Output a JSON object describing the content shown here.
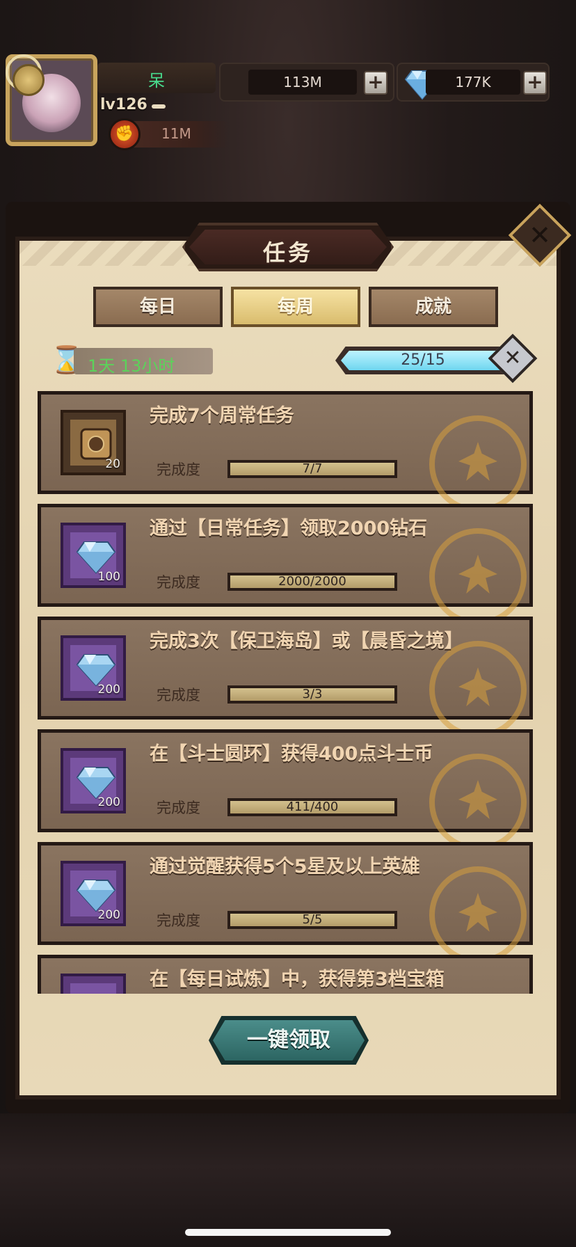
{
  "player": {
    "name": "呆",
    "level": "lv126",
    "power": "11M"
  },
  "resources": {
    "gold": "113M",
    "gems": "177K"
  },
  "dialog": {
    "title": "任务",
    "close_label": "✕"
  },
  "tabs": [
    {
      "label": "每日",
      "active": false
    },
    {
      "label": "每周",
      "active": true
    },
    {
      "label": "成就",
      "active": false
    }
  ],
  "timer": "1天 13小时",
  "weekly_progress": {
    "text": "25/15",
    "fraction": 1.0
  },
  "tasks": [
    {
      "title": "完成7个周常任务",
      "reward_type": "book",
      "reward_count": "20",
      "completion_label": "完成度",
      "progress_text": "7/7",
      "progress": 1.0
    },
    {
      "title": "通过【日常任务】领取2000钻石",
      "reward_type": "gem",
      "reward_count": "100",
      "completion_label": "完成度",
      "progress_text": "2000/2000",
      "progress": 1.0
    },
    {
      "title": "完成3次【保卫海岛】或【晨昏之境】",
      "reward_type": "gem",
      "reward_count": "200",
      "completion_label": "完成度",
      "progress_text": "3/3",
      "progress": 1.0
    },
    {
      "title": "在【斗士圆环】获得400点斗士币",
      "reward_type": "gem",
      "reward_count": "200",
      "completion_label": "完成度",
      "progress_text": "411/400",
      "progress": 1.0
    },
    {
      "title": "通过觉醒获得5个5星及以上英雄",
      "reward_type": "gem",
      "reward_count": "200",
      "completion_label": "完成度",
      "progress_text": "5/5",
      "progress": 1.0
    },
    {
      "title": "在【每日试炼】中，获得第3档宝箱",
      "reward_type": "gem",
      "reward_count": "",
      "completion_label": "",
      "progress_text": "",
      "progress": 0
    }
  ],
  "collect_all_label": "一键领取"
}
